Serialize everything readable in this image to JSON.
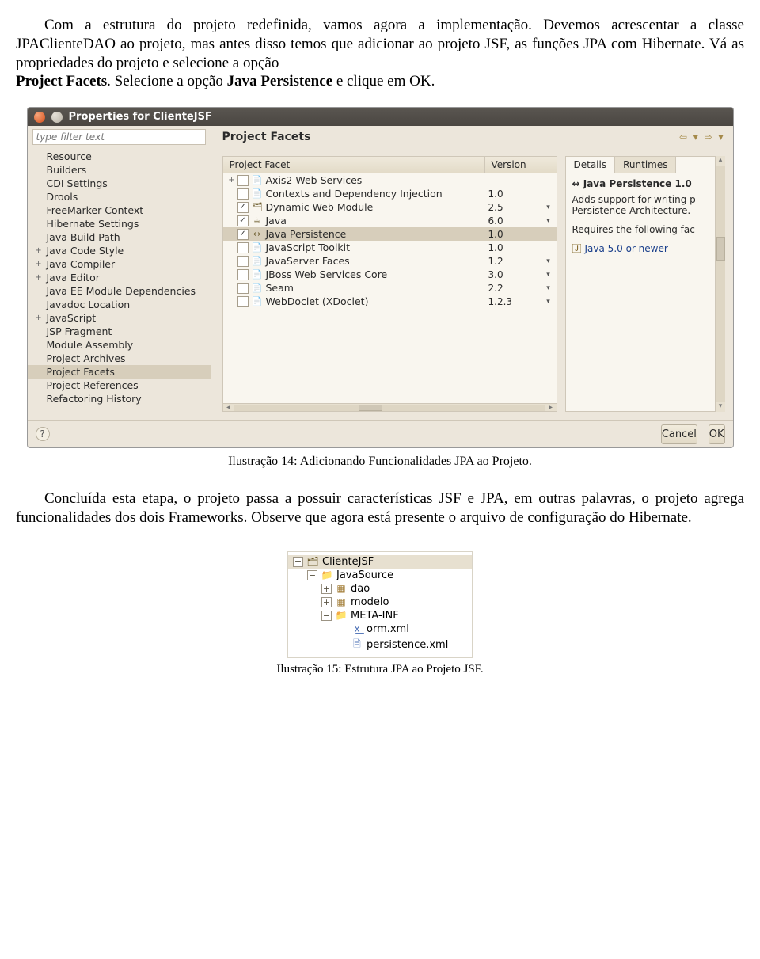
{
  "para1_a": "Com a estrutura do projeto redefinida, vamos agora a implementação. Devemos acrescentar a classe JPAClienteDAO ao projeto, mas antes disso temos que adicionar ao projeto JSF, as funções JPA com Hibernate. Vá as propriedades do projeto e selecione a opção ",
  "para1_b": "Project Facets",
  "para1_c": ". Selecione a opção ",
  "para1_d": "Java Persistence",
  "para1_e": "  e clique em OK.",
  "dialog": {
    "title": "Properties for ClienteJSF",
    "filter_placeholder": "type filter text",
    "sidebar": [
      {
        "tw": "",
        "label": "Resource"
      },
      {
        "tw": "",
        "label": "Builders"
      },
      {
        "tw": "",
        "label": "CDI Settings"
      },
      {
        "tw": "",
        "label": "Drools"
      },
      {
        "tw": "",
        "label": "FreeMarker Context"
      },
      {
        "tw": "",
        "label": "Hibernate Settings"
      },
      {
        "tw": "",
        "label": "Java Build Path"
      },
      {
        "tw": "+",
        "label": "Java Code Style"
      },
      {
        "tw": "+",
        "label": "Java Compiler"
      },
      {
        "tw": "+",
        "label": "Java Editor"
      },
      {
        "tw": "",
        "label": "Java EE Module Dependencies"
      },
      {
        "tw": "",
        "label": "Javadoc Location"
      },
      {
        "tw": "+",
        "label": "JavaScript"
      },
      {
        "tw": "",
        "label": "JSP Fragment"
      },
      {
        "tw": "",
        "label": "Module Assembly"
      },
      {
        "tw": "",
        "label": "Project Archives"
      },
      {
        "tw": "",
        "label": "Project Facets",
        "sel": true
      },
      {
        "tw": "",
        "label": "Project References"
      },
      {
        "tw": "",
        "label": "Refactoring History"
      }
    ],
    "main_title": "Project Facets",
    "columns": {
      "c1": "Project Facet",
      "c2": "Version"
    },
    "facets": [
      {
        "tw": "+",
        "checked": false,
        "icon": "📄",
        "name": "Axis2 Web Services",
        "ver": "",
        "dd": ""
      },
      {
        "tw": "",
        "checked": false,
        "icon": "📄",
        "name": "Contexts and Dependency Injection",
        "ver": "1.0",
        "dd": ""
      },
      {
        "tw": "",
        "checked": true,
        "icon": "🗂",
        "name": "Dynamic Web Module",
        "ver": "2.5",
        "dd": "▾"
      },
      {
        "tw": "",
        "checked": true,
        "icon": "☕",
        "name": "Java",
        "ver": "6.0",
        "dd": "▾"
      },
      {
        "tw": "",
        "checked": true,
        "icon": "↔",
        "name": "Java Persistence",
        "ver": "1.0",
        "dd": "",
        "sel": true
      },
      {
        "tw": "",
        "checked": false,
        "icon": "📄",
        "name": "JavaScript Toolkit",
        "ver": "1.0",
        "dd": ""
      },
      {
        "tw": "",
        "checked": false,
        "icon": "📄",
        "name": "JavaServer Faces",
        "ver": "1.2",
        "dd": "▾"
      },
      {
        "tw": "",
        "checked": false,
        "icon": "📄",
        "name": "JBoss Web Services Core",
        "ver": "3.0",
        "dd": "▾"
      },
      {
        "tw": "",
        "checked": false,
        "icon": "📄",
        "name": "Seam",
        "ver": "2.2",
        "dd": "▾"
      },
      {
        "tw": "",
        "checked": false,
        "icon": "📄",
        "name": "WebDoclet (XDoclet)",
        "ver": "1.2.3",
        "dd": "▾"
      }
    ],
    "tabs": {
      "details": "Details",
      "runtimes": "Runtimes"
    },
    "det_heading": "↔ Java Persistence 1.0",
    "det_desc1": "Adds support for writing p",
    "det_desc2": "Persistence Architecture.",
    "det_req": "Requires the following fac",
    "det_req_item": "Java 5.0 or newer",
    "cancel": "Cancel",
    "ok": "OK"
  },
  "caption1": "Ilustração 14: Adicionando Funcionalidades JPA ao Projeto.",
  "para2": "Concluída esta etapa, o projeto passa a possuir características JSF e JPA, em outras palavras, o projeto agrega funcionalidades dos dois Frameworks. Observe que agora  está presente o arquivo de configuração do Hibernate.",
  "tree2": {
    "root": "ClienteJSF",
    "items": [
      {
        "pm": "−",
        "ind": 0,
        "icon": "🗂",
        "cls": "proj",
        "label": "ClienteJSF",
        "sel": true
      },
      {
        "pm": "−",
        "ind": 1,
        "icon": "📁",
        "cls": "folder",
        "label": "JavaSource"
      },
      {
        "pm": "+",
        "ind": 2,
        "icon": "▦",
        "cls": "pkg",
        "label": "dao"
      },
      {
        "pm": "+",
        "ind": 2,
        "icon": "▦",
        "cls": "pkg",
        "label": "modelo"
      },
      {
        "pm": "−",
        "ind": 2,
        "icon": "📁",
        "cls": "folder",
        "label": "META-INF"
      },
      {
        "pm": "",
        "ind": 3,
        "icon": "x͟",
        "cls": "xml",
        "label": "orm.xml"
      },
      {
        "pm": "",
        "ind": 3,
        "icon": "🗎",
        "cls": "xml",
        "label": "persistence.xml"
      }
    ]
  },
  "caption2": "Ilustração 15: Estrutura JPA ao Projeto JSF."
}
